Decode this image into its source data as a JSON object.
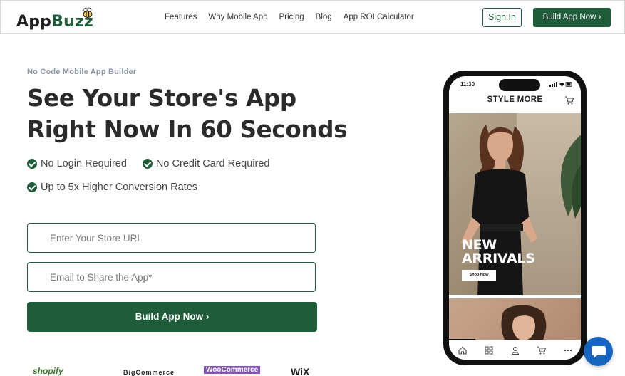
{
  "header": {
    "logo_prefix": "App",
    "logo_suffix": "Buzz",
    "nav": [
      "Features",
      "Why Mobile App",
      "Pricing",
      "Blog",
      "App ROI Calculator"
    ],
    "sign_in": "Sign In",
    "cta": "Build App Now ›"
  },
  "hero": {
    "eyebrow": "No Code Mobile App Builder",
    "headline_line1": "See Your Store's App",
    "headline_line2": "Right Now In 60 Seconds",
    "checks": [
      "No Login Required",
      "No Credit Card Required",
      "Up to 5x Higher Conversion Rates"
    ],
    "store_url_placeholder": "Enter Your Store URL",
    "email_placeholder": "Email to Share the App*",
    "cta": "Build App Now ›"
  },
  "platforms": [
    "shopify",
    "BigCommerce",
    "WooCommerce",
    "WiX"
  ],
  "phone": {
    "time": "11:30",
    "store_title": "STYLE MORE",
    "banner_heading_line1": "NEW",
    "banner_heading_line2": "ARRIVALS",
    "banner_button": "Shop Now",
    "tabs": [
      "home-icon",
      "grid-icon",
      "user-icon",
      "cart-icon",
      "more-icon"
    ]
  },
  "colors": {
    "brand_green": "#1f5d3a",
    "chat_blue": "#1565c0"
  }
}
